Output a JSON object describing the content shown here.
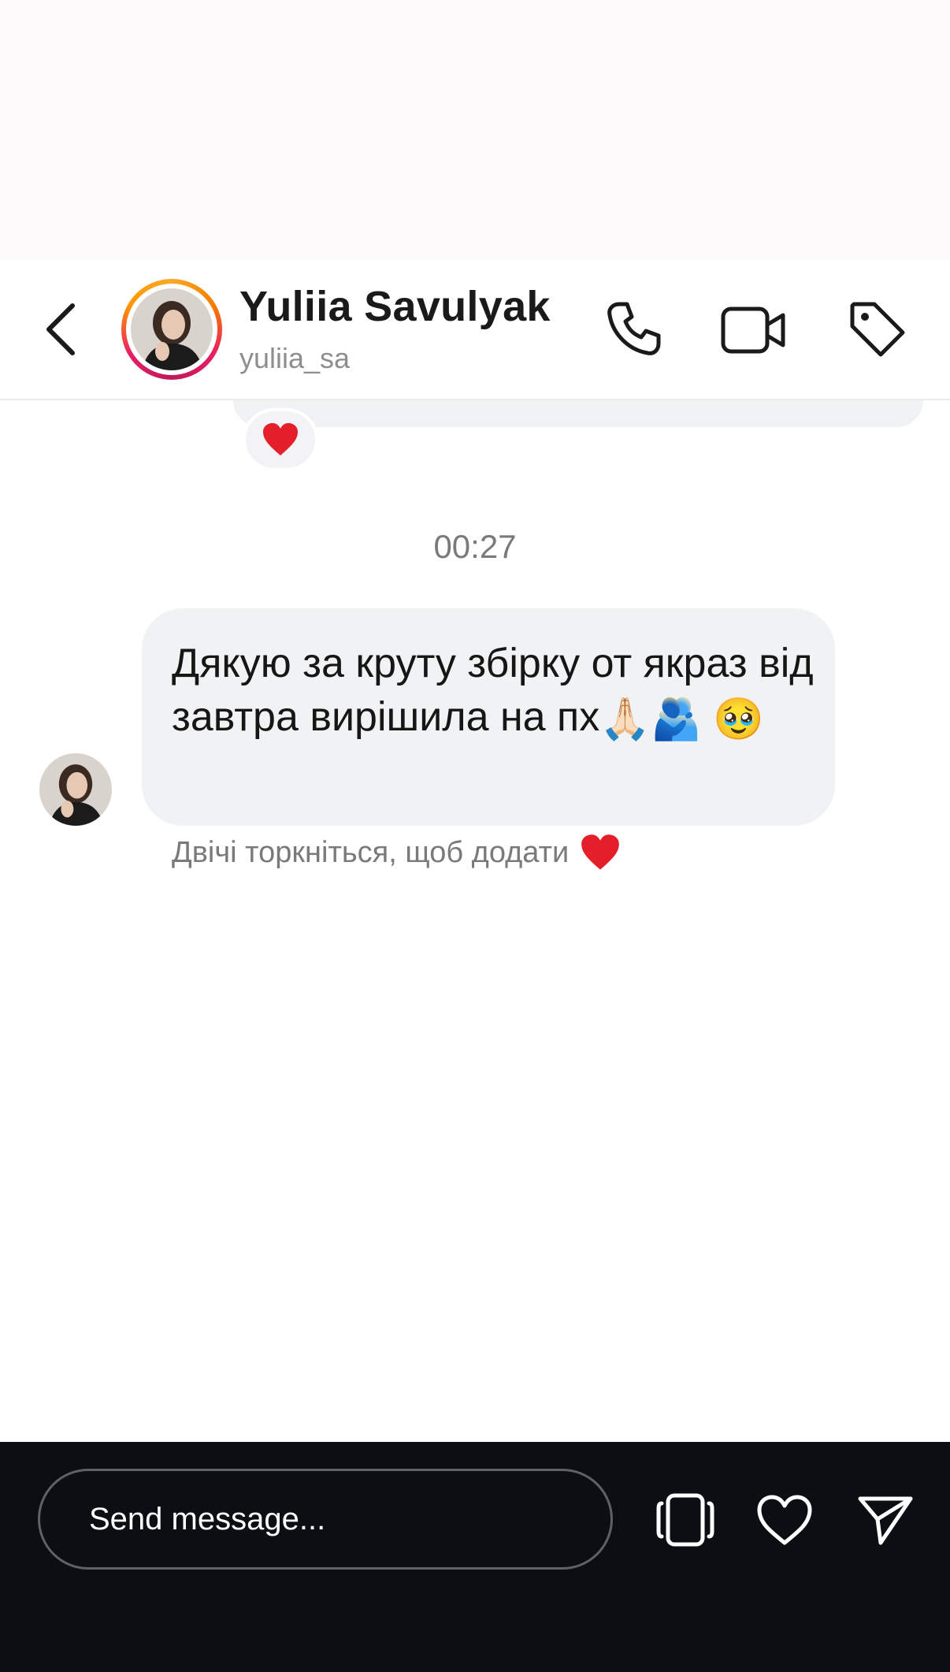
{
  "header": {
    "name": "Yuliia Savulyak",
    "username": "yuliia_sa",
    "icons": [
      "back-icon",
      "phone-icon",
      "video-icon",
      "tag-icon"
    ]
  },
  "conversation": {
    "previous_reaction": "heart-emoji",
    "timestamp": "00:27",
    "message": {
      "text": "Дякую за круту збірку от якраз від завтра вирішила на пх",
      "emojis": [
        "🙏🏻",
        "🫂",
        "🥹"
      ]
    },
    "hint": "Двічі торкніться, щоб додати"
  },
  "composer": {
    "placeholder": "Send message...",
    "icons": [
      "sticker-icon",
      "heart-icon",
      "send-icon"
    ]
  },
  "colors": {
    "bubble": "#f1f2f4",
    "bottom_bar": "#0b0f14",
    "heart": "#e41e2b"
  }
}
